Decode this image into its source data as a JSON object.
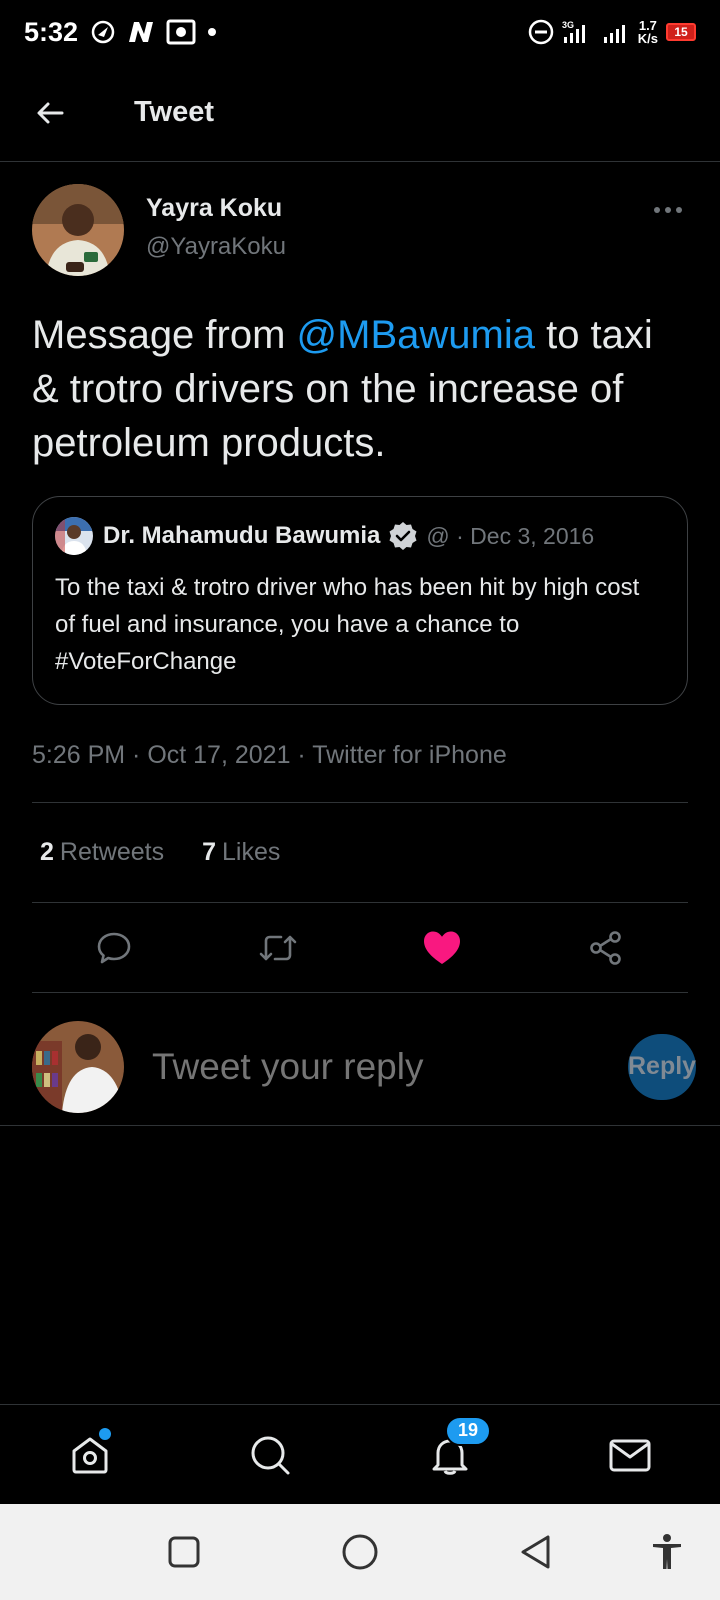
{
  "status_bar": {
    "time": "5:32",
    "network_speed_value": "1.7",
    "network_speed_unit": "K/s",
    "battery_level": "15",
    "icons": [
      "navigation-icon",
      "n-app-icon",
      "photo-app-icon",
      "dot-icon",
      "dnd-icon",
      "signal-4g-icon",
      "signal-icon",
      "battery-icon"
    ]
  },
  "header": {
    "title": "Tweet"
  },
  "tweet": {
    "author_name": "Yayra Koku",
    "author_handle": "@YayraKoku",
    "text_before": "Message from ",
    "mention": "@MBawumia",
    "text_after": " to taxi & trotro drivers on the increase of petroleum products.",
    "quoted": {
      "author_name": "Dr. Mahamudu Bawumia",
      "handle_date": "@ · Dec 3, 2016",
      "text": "To the taxi & trotro driver who has been hit by high cost of fuel and insurance, you have a chance to #VoteForChange"
    },
    "meta": "5:26 PM · Oct 17, 2021 · Twitter for iPhone",
    "retweets_count": "2",
    "retweets_label": "Retweets",
    "likes_count": "7",
    "likes_label": "Likes",
    "liked": true
  },
  "reply": {
    "placeholder": "Tweet your reply",
    "button": "Reply"
  },
  "tabbar": {
    "notifications_badge": "19"
  },
  "colors": {
    "accent": "#1d9bf0",
    "like": "#f91880",
    "background": "#000000",
    "muted": "#71767b"
  }
}
